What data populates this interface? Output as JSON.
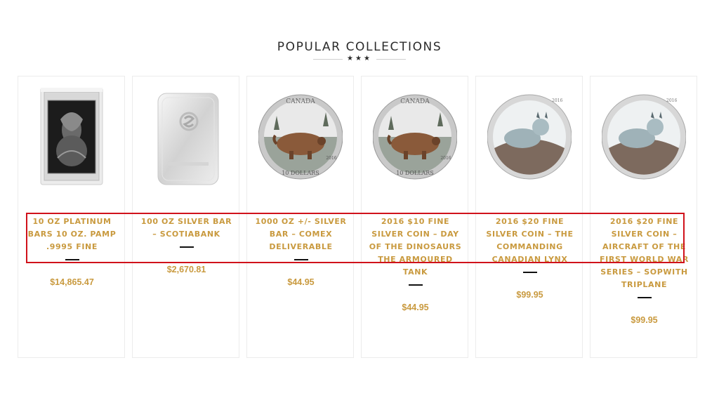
{
  "section": {
    "title": "POPULAR COLLECTIONS",
    "decoration_icon": "three-stars-icon"
  },
  "products": [
    {
      "name": "10 OZ PLATINUM BARS 10 OZ. PAMP .9995 FINE",
      "price": "$14,865.47",
      "image": "platinum-bar-image"
    },
    {
      "name": "100 OZ SILVER BAR – SCOTIABANK",
      "price": "$2,670.81",
      "image": "silver-bar-image"
    },
    {
      "name": "1000 OZ +/- SILVER BAR – COMEX DELIVERABLE",
      "price": "$44.95",
      "image": "ankylosaurus-coin-image"
    },
    {
      "name": "2016 $10 FINE SILVER COIN – DAY OF THE DINOSAURS THE ARMOURED TANK",
      "price": "$44.95",
      "image": "ankylosaurus-coin-image"
    },
    {
      "name": "2016 $20 FINE SILVER COIN – THE COMMANDING CANADIAN LYNX",
      "price": "$99.95",
      "image": "lynx-coin-image"
    },
    {
      "name": "2016 $20 FINE SILVER COIN – AIRCRAFT OF THE FIRST WORLD WAR SERIES – SOPWITH TRIPLANE",
      "price": "$99.95",
      "image": "lynx-coin-image"
    }
  ],
  "coin_text": {
    "country": "CANADA",
    "dino_denomination": "10 DOLLARS",
    "dino_year": "2016",
    "lynx_year": "2016"
  },
  "colors": {
    "accent_gold": "#c99a3f",
    "highlight_red": "#d0121b",
    "title_dark": "#2b2b2b"
  }
}
